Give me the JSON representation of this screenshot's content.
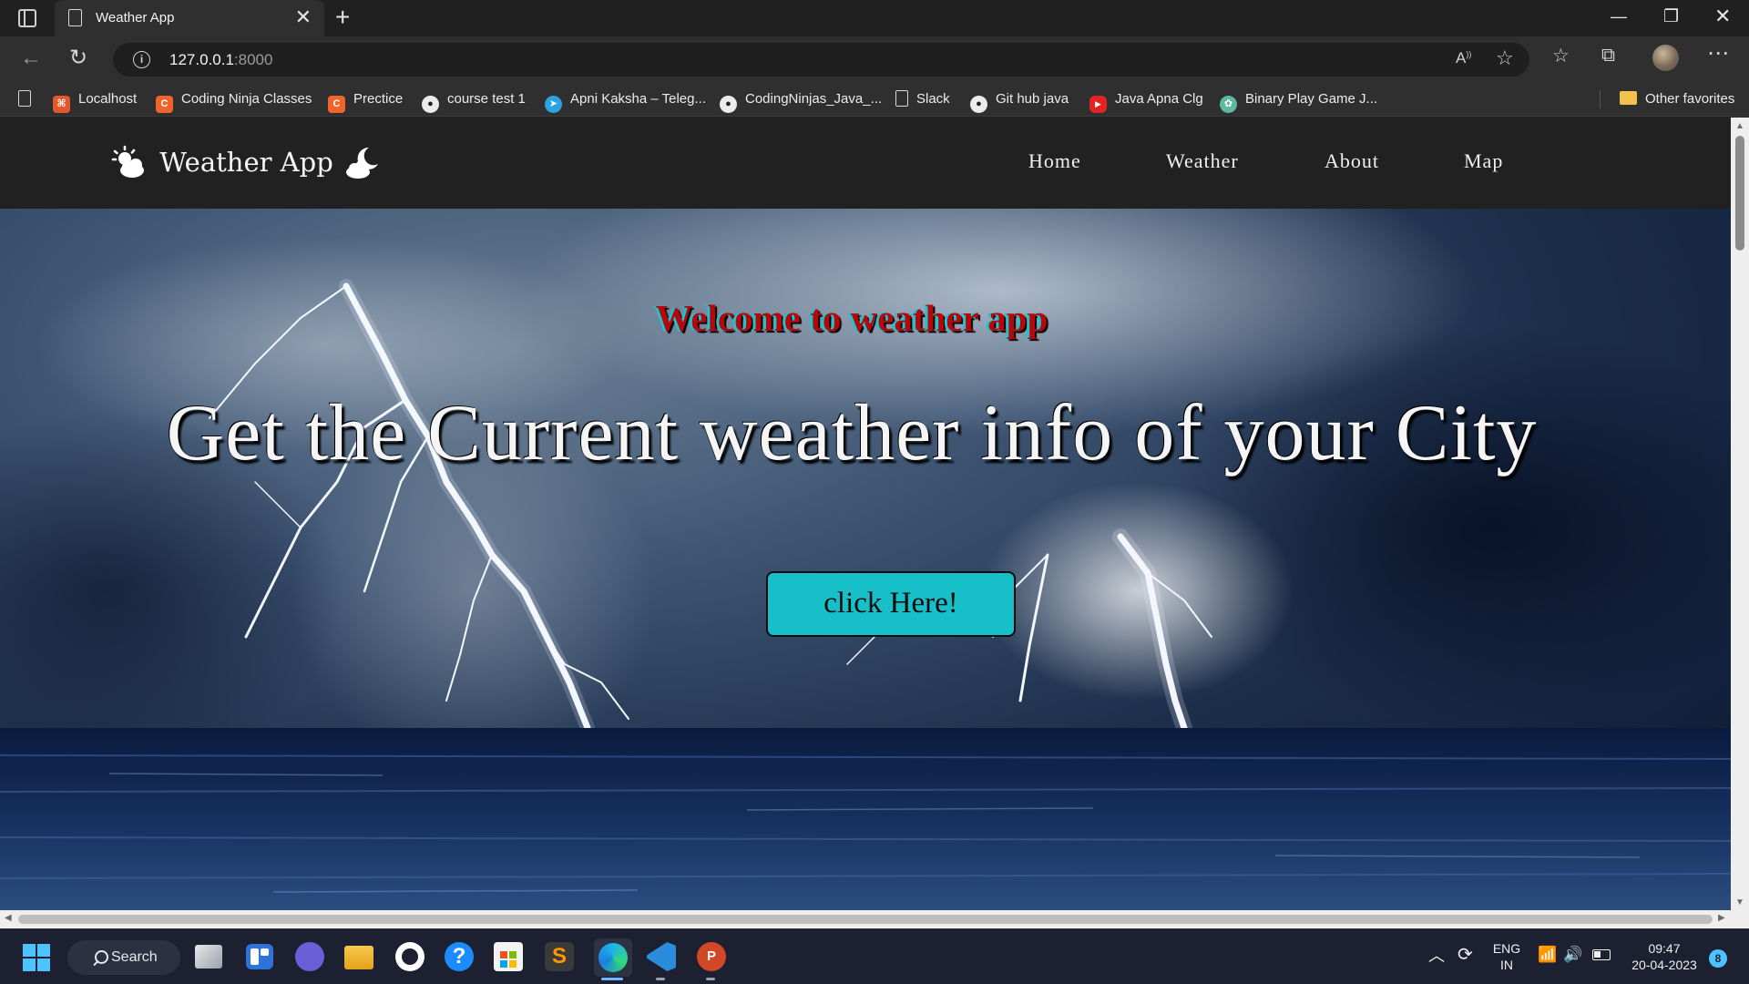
{
  "browser": {
    "tab_title": "Weather App",
    "url_host": "127.0.0.1",
    "url_port": ":8000",
    "bookmarks": [
      "Localhost",
      "Coding Ninja Classes",
      "Prectice",
      "course test 1",
      "Apni Kaksha – Teleg...",
      "CodingNinjas_Java_...",
      "Slack",
      "Git hub java",
      "Java Apna Clg",
      "Binary Play Game J..."
    ],
    "other_favorites": "Other favorites"
  },
  "page": {
    "brand": "Weather App",
    "nav": [
      "Home",
      "Weather",
      "About",
      "Map"
    ],
    "welcome": "Welcome to weather app",
    "headline": "Get the Current weather info of your City",
    "cta_label": "click Here!"
  },
  "taskbar": {
    "search_label": "Search",
    "lang_line1": "ENG",
    "lang_line2": "IN",
    "time": "09:47",
    "date": "20-04-2023",
    "notification_count": "8"
  },
  "colors": {
    "cta_bg": "#17c0c9",
    "welcome_text": "#b5080c",
    "navbar_bg": "#212121"
  },
  "icons": [
    "sidebar-icon",
    "document-icon",
    "close-icon",
    "plus-icon",
    "back-icon",
    "refresh-icon",
    "info-icon",
    "read-aloud-icon",
    "favorite-add-icon",
    "favorites-icon",
    "collections-icon",
    "more-icon",
    "folder-icon",
    "cloud-sun-icon",
    "cloud-moon-icon",
    "windows-start-icon",
    "search-icon",
    "wifi-icon",
    "speaker-icon",
    "battery-icon"
  ]
}
